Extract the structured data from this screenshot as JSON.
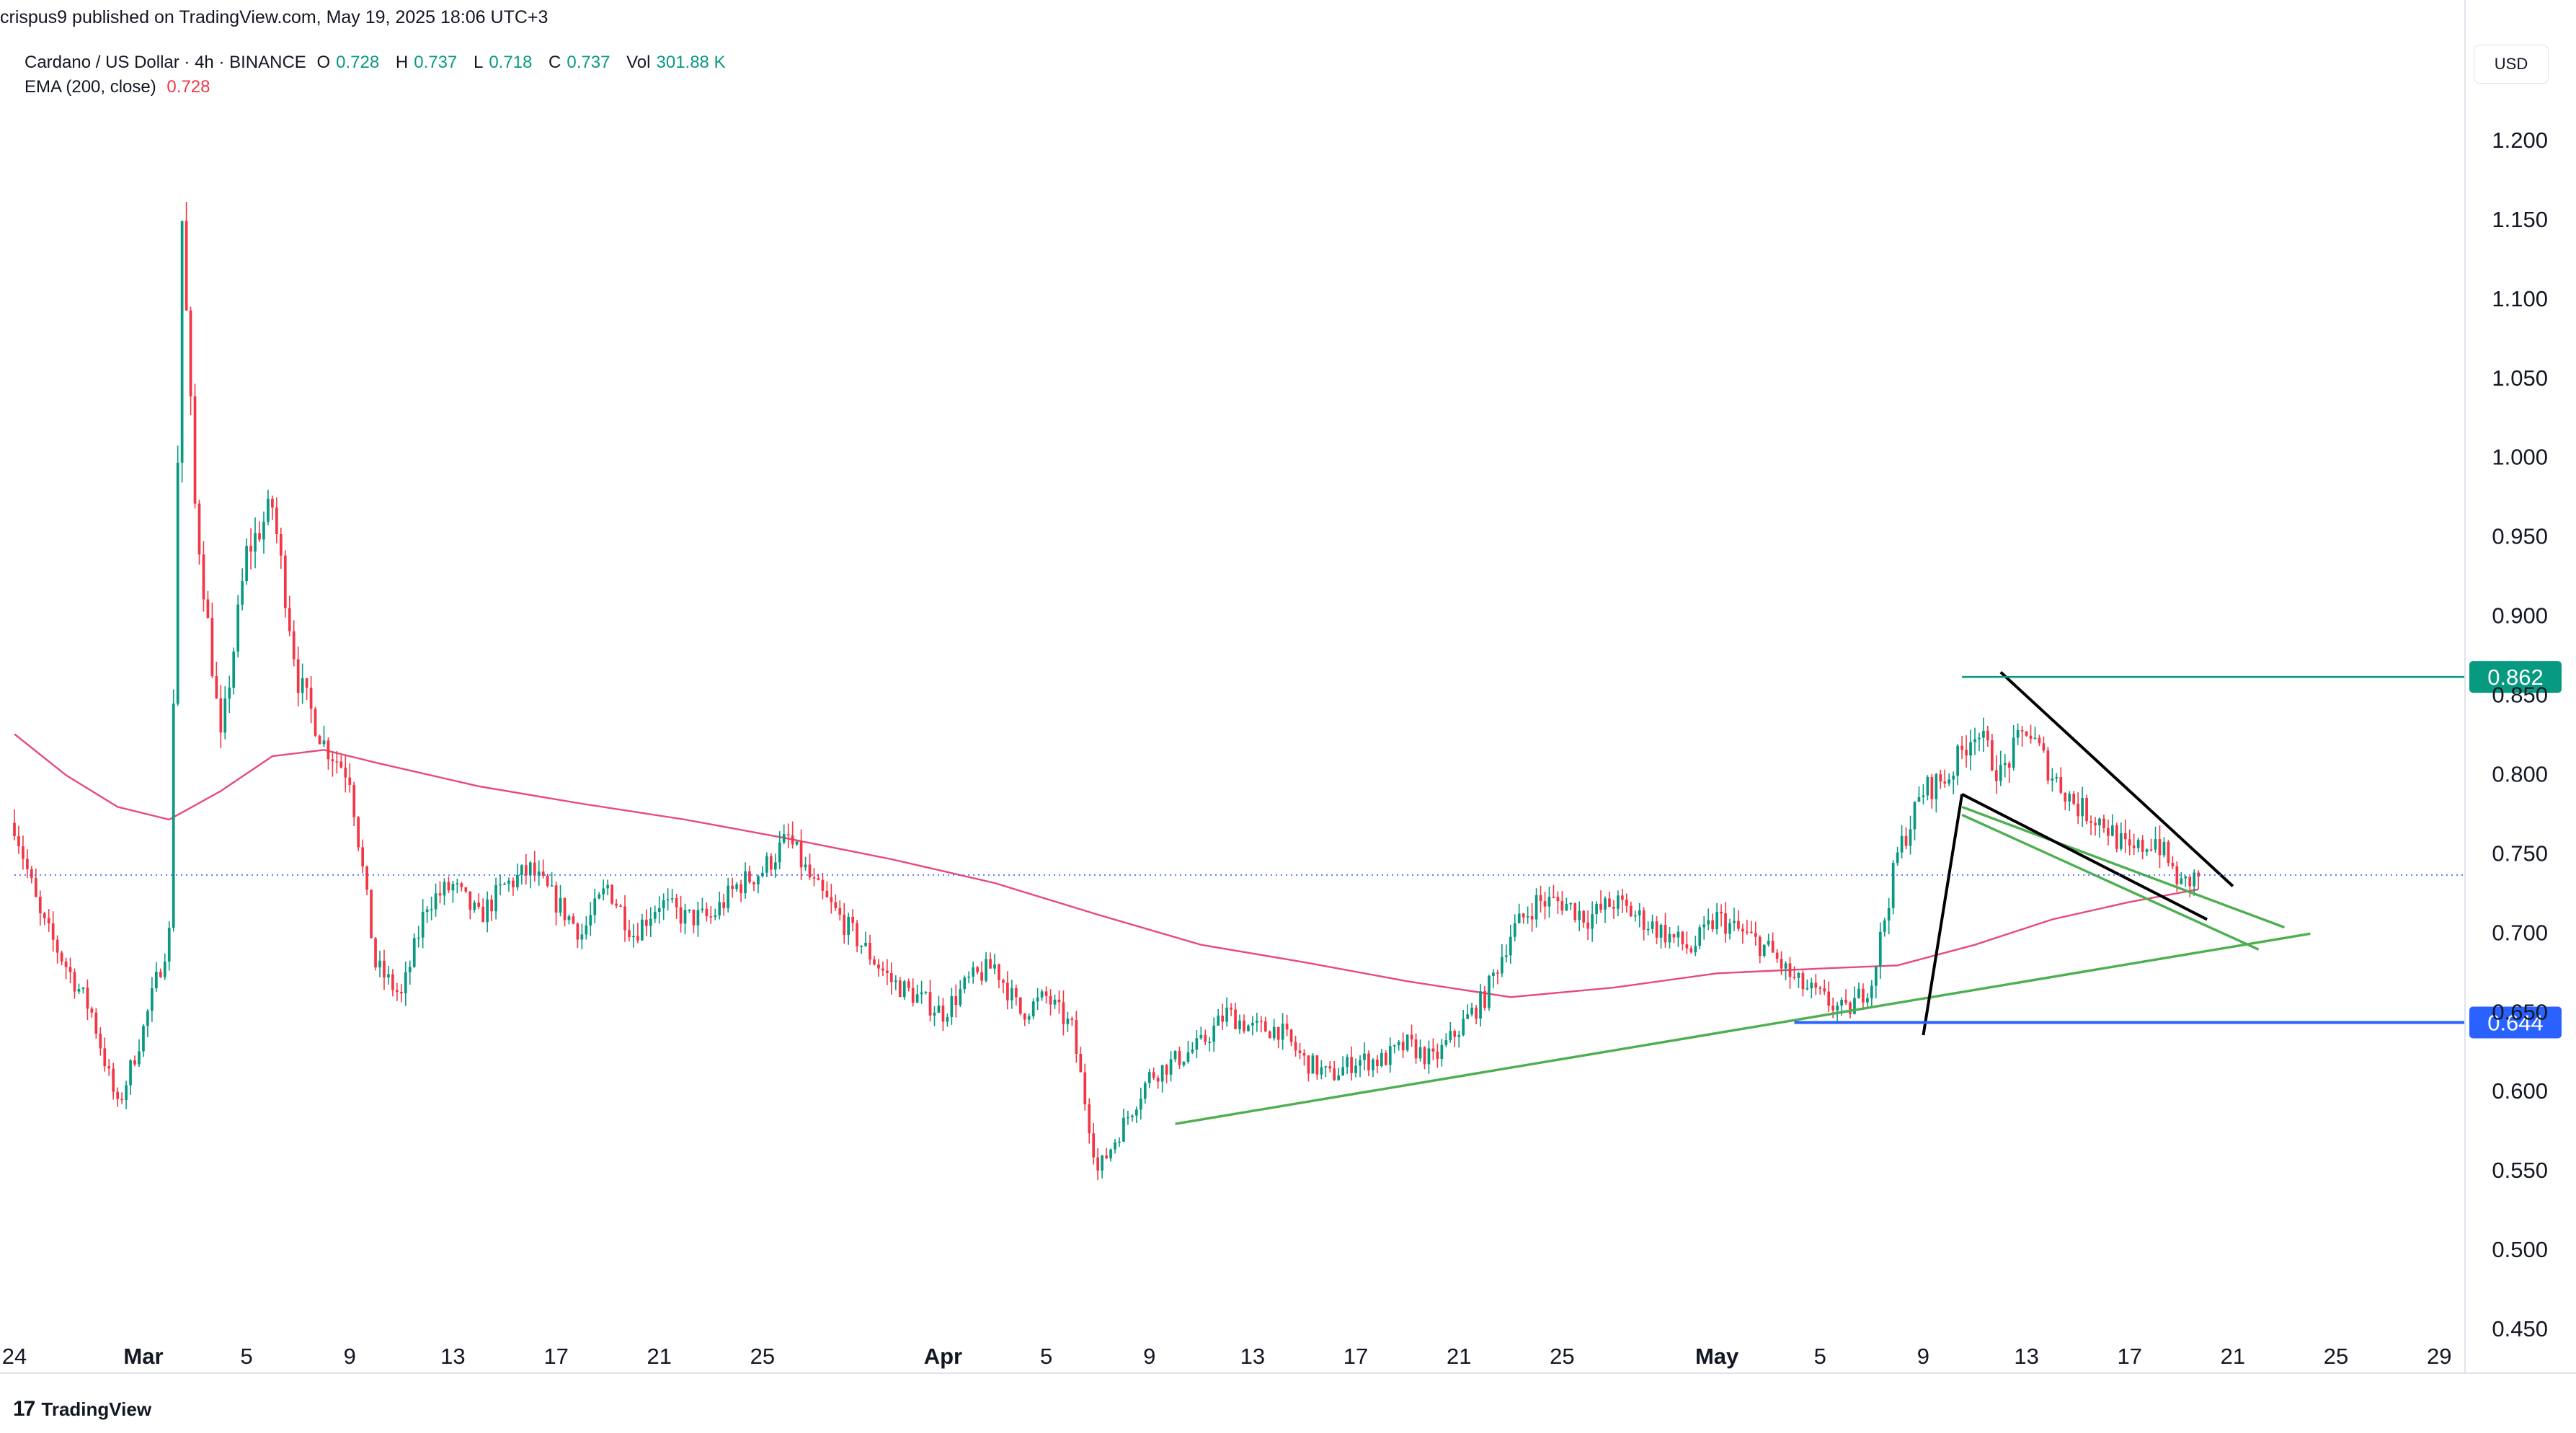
{
  "header": {
    "published": "crispus9 published on TradingView.com, May 19, 2025 18:06 UTC+3"
  },
  "legend": {
    "symbol": "Cardano / US Dollar · 4h · BINANCE",
    "o_label": "O",
    "o_value": "0.728",
    "h_label": "H",
    "h_value": "0.737",
    "l_label": "L",
    "l_value": "0.718",
    "c_label": "C",
    "c_value": "0.737",
    "vol_label": "Vol",
    "vol_value": "301.88 K",
    "ema_label": "EMA (200, close)",
    "ema_value": "0.728"
  },
  "currency_button": "USD",
  "brand": "TradingView",
  "colors": {
    "up": "#089981",
    "down": "#f23645",
    "ema": "#e8497a",
    "trend_green": "#4caf50",
    "resistance": "#089981",
    "support": "#2962ff",
    "wedge": "#000000",
    "price_line": "#2962ff"
  },
  "chart_data": {
    "type": "candlestick",
    "x_tick_labels": [
      "24",
      "Mar",
      "5",
      "9",
      "13",
      "17",
      "21",
      "25",
      "Apr",
      "5",
      "9",
      "13",
      "17",
      "21",
      "25",
      "May",
      "5",
      "9",
      "13",
      "17",
      "21",
      "25",
      "29"
    ],
    "x_ticks": [
      "2025-02-24",
      "2025-03-01",
      "2025-03-05",
      "2025-03-09",
      "2025-03-13",
      "2025-03-17",
      "2025-03-21",
      "2025-03-25",
      "2025-04-01",
      "2025-04-05",
      "2025-04-09",
      "2025-04-13",
      "2025-04-17",
      "2025-04-21",
      "2025-04-25",
      "2025-05-01",
      "2025-05-05",
      "2025-05-09",
      "2025-05-13",
      "2025-05-17",
      "2025-05-21",
      "2025-05-25",
      "2025-05-29"
    ],
    "y_tick_labels": [
      "1.200",
      "1.150",
      "1.100",
      "1.050",
      "1.000",
      "0.950",
      "0.900",
      "0.850",
      "0.800",
      "0.750",
      "0.700",
      "0.650",
      "0.600",
      "0.550",
      "0.500",
      "0.450"
    ],
    "y_ticks": [
      1.2,
      1.15,
      1.1,
      1.05,
      1.0,
      0.95,
      0.9,
      0.85,
      0.8,
      0.75,
      0.7,
      0.65,
      0.6,
      0.55,
      0.5,
      0.45
    ],
    "ylim": [
      0.45,
      1.23
    ],
    "xlim": [
      "2025-02-24",
      "2025-05-30"
    ],
    "price_key_points": [
      [
        "2025-02-24",
        0.77
      ],
      [
        "2025-02-25",
        0.71
      ],
      [
        "2025-02-26",
        0.68
      ],
      [
        "2025-02-27",
        0.65
      ],
      [
        "2025-02-28",
        0.59
      ],
      [
        "2025-03-01",
        0.64
      ],
      [
        "2025-03-02",
        0.7
      ],
      [
        "2025-03-02T12:00",
        1.15
      ],
      [
        "2025-03-03",
        0.97
      ],
      [
        "2025-03-04",
        0.82
      ],
      [
        "2025-03-05",
        0.94
      ],
      [
        "2025-03-06",
        0.97
      ],
      [
        "2025-03-07",
        0.86
      ],
      [
        "2025-03-08",
        0.82
      ],
      [
        "2025-03-09",
        0.8
      ],
      [
        "2025-03-10",
        0.68
      ],
      [
        "2025-03-11",
        0.66
      ],
      [
        "2025-03-12",
        0.72
      ],
      [
        "2025-03-13",
        0.73
      ],
      [
        "2025-03-14",
        0.71
      ],
      [
        "2025-03-15",
        0.73
      ],
      [
        "2025-03-16",
        0.74
      ],
      [
        "2025-03-17",
        0.72
      ],
      [
        "2025-03-18",
        0.7
      ],
      [
        "2025-03-19",
        0.73
      ],
      [
        "2025-03-20",
        0.7
      ],
      [
        "2025-03-21",
        0.72
      ],
      [
        "2025-03-22",
        0.71
      ],
      [
        "2025-03-23",
        0.71
      ],
      [
        "2025-03-24",
        0.73
      ],
      [
        "2025-03-25",
        0.74
      ],
      [
        "2025-03-26",
        0.76
      ],
      [
        "2025-03-27",
        0.73
      ],
      [
        "2025-03-28",
        0.71
      ],
      [
        "2025-03-29",
        0.69
      ],
      [
        "2025-03-30",
        0.67
      ],
      [
        "2025-03-31",
        0.66
      ],
      [
        "2025-04-01",
        0.65
      ],
      [
        "2025-04-02",
        0.67
      ],
      [
        "2025-04-03",
        0.68
      ],
      [
        "2025-04-04",
        0.65
      ],
      [
        "2025-04-05",
        0.66
      ],
      [
        "2025-04-06",
        0.64
      ],
      [
        "2025-04-07",
        0.55
      ],
      [
        "2025-04-08",
        0.58
      ],
      [
        "2025-04-09",
        0.61
      ],
      [
        "2025-04-10",
        0.62
      ],
      [
        "2025-04-11",
        0.63
      ],
      [
        "2025-04-12",
        0.65
      ],
      [
        "2025-04-13",
        0.64
      ],
      [
        "2025-04-14",
        0.64
      ],
      [
        "2025-04-15",
        0.62
      ],
      [
        "2025-04-16",
        0.61
      ],
      [
        "2025-04-17",
        0.62
      ],
      [
        "2025-04-18",
        0.62
      ],
      [
        "2025-04-19",
        0.63
      ],
      [
        "2025-04-20",
        0.62
      ],
      [
        "2025-04-21",
        0.64
      ],
      [
        "2025-04-22",
        0.66
      ],
      [
        "2025-04-23",
        0.7
      ],
      [
        "2025-04-24",
        0.72
      ],
      [
        "2025-04-25",
        0.72
      ],
      [
        "2025-04-26",
        0.71
      ],
      [
        "2025-04-27",
        0.72
      ],
      [
        "2025-04-28",
        0.71
      ],
      [
        "2025-04-29",
        0.7
      ],
      [
        "2025-04-30",
        0.69
      ],
      [
        "2025-05-01",
        0.71
      ],
      [
        "2025-05-02",
        0.7
      ],
      [
        "2025-05-03",
        0.69
      ],
      [
        "2025-05-04",
        0.67
      ],
      [
        "2025-05-05",
        0.66
      ],
      [
        "2025-05-06",
        0.65
      ],
      [
        "2025-05-07",
        0.67
      ],
      [
        "2025-05-08",
        0.75
      ],
      [
        "2025-05-09",
        0.79
      ],
      [
        "2025-05-10",
        0.8
      ],
      [
        "2025-05-11",
        0.83
      ],
      [
        "2025-05-12",
        0.8
      ],
      [
        "2025-05-13",
        0.83
      ],
      [
        "2025-05-14",
        0.8
      ],
      [
        "2025-05-15",
        0.78
      ],
      [
        "2025-05-16",
        0.77
      ],
      [
        "2025-05-17",
        0.75
      ],
      [
        "2025-05-18",
        0.76
      ],
      [
        "2025-05-19",
        0.73
      ],
      [
        "2025-05-19T16:00",
        0.737
      ]
    ],
    "ema_200": [
      [
        "2025-02-24",
        0.826
      ],
      [
        "2025-02-26",
        0.8
      ],
      [
        "2025-02-28",
        0.78
      ],
      [
        "2025-03-02",
        0.772
      ],
      [
        "2025-03-04",
        0.79
      ],
      [
        "2025-03-06",
        0.812
      ],
      [
        "2025-03-08",
        0.816
      ],
      [
        "2025-03-10",
        0.808
      ],
      [
        "2025-03-14",
        0.793
      ],
      [
        "2025-03-18",
        0.782
      ],
      [
        "2025-03-22",
        0.772
      ],
      [
        "2025-03-26",
        0.76
      ],
      [
        "2025-03-30",
        0.747
      ],
      [
        "2025-04-03",
        0.732
      ],
      [
        "2025-04-07",
        0.712
      ],
      [
        "2025-04-11",
        0.693
      ],
      [
        "2025-04-15",
        0.682
      ],
      [
        "2025-04-19",
        0.67
      ],
      [
        "2025-04-23",
        0.66
      ],
      [
        "2025-04-27",
        0.666
      ],
      [
        "2025-05-01",
        0.675
      ],
      [
        "2025-05-05",
        0.678
      ],
      [
        "2025-05-08",
        0.68
      ],
      [
        "2025-05-11",
        0.693
      ],
      [
        "2025-05-14",
        0.709
      ],
      [
        "2025-05-17",
        0.72
      ],
      [
        "2025-05-19T16:00",
        0.728
      ]
    ],
    "drawings": [
      {
        "kind": "ascending-trendline",
        "from": [
          "2025-04-10",
          0.58
        ],
        "to": [
          "2025-05-24",
          0.7
        ]
      },
      {
        "kind": "channel-upper",
        "from": [
          "2025-05-10T12:00",
          0.78
        ],
        "to": [
          "2025-05-23",
          0.704
        ]
      },
      {
        "kind": "channel-lower",
        "from": [
          "2025-05-10T12:00",
          0.775
        ],
        "to": [
          "2025-05-22",
          0.69
        ]
      },
      {
        "kind": "wedge-upper",
        "from": [
          "2025-05-12",
          0.865
        ],
        "to": [
          "2025-05-21",
          0.73
        ]
      },
      {
        "kind": "wedge-lower",
        "from": [
          "2025-05-10T12:00",
          0.788
        ],
        "to": [
          "2025-05-20",
          0.709
        ]
      },
      {
        "kind": "flagpole",
        "from": [
          "2025-05-09",
          0.636
        ],
        "to": [
          "2025-05-10T12:00",
          0.788
        ]
      }
    ],
    "horizontal_levels": [
      {
        "name": "resistance",
        "value": 0.862,
        "label": "0.862",
        "from": "2025-05-10T12:00"
      },
      {
        "name": "support",
        "value": 0.644,
        "label": "0.644",
        "from": "2025-05-04"
      },
      {
        "name": "current-price",
        "value": 0.737,
        "dotted": true
      }
    ]
  }
}
